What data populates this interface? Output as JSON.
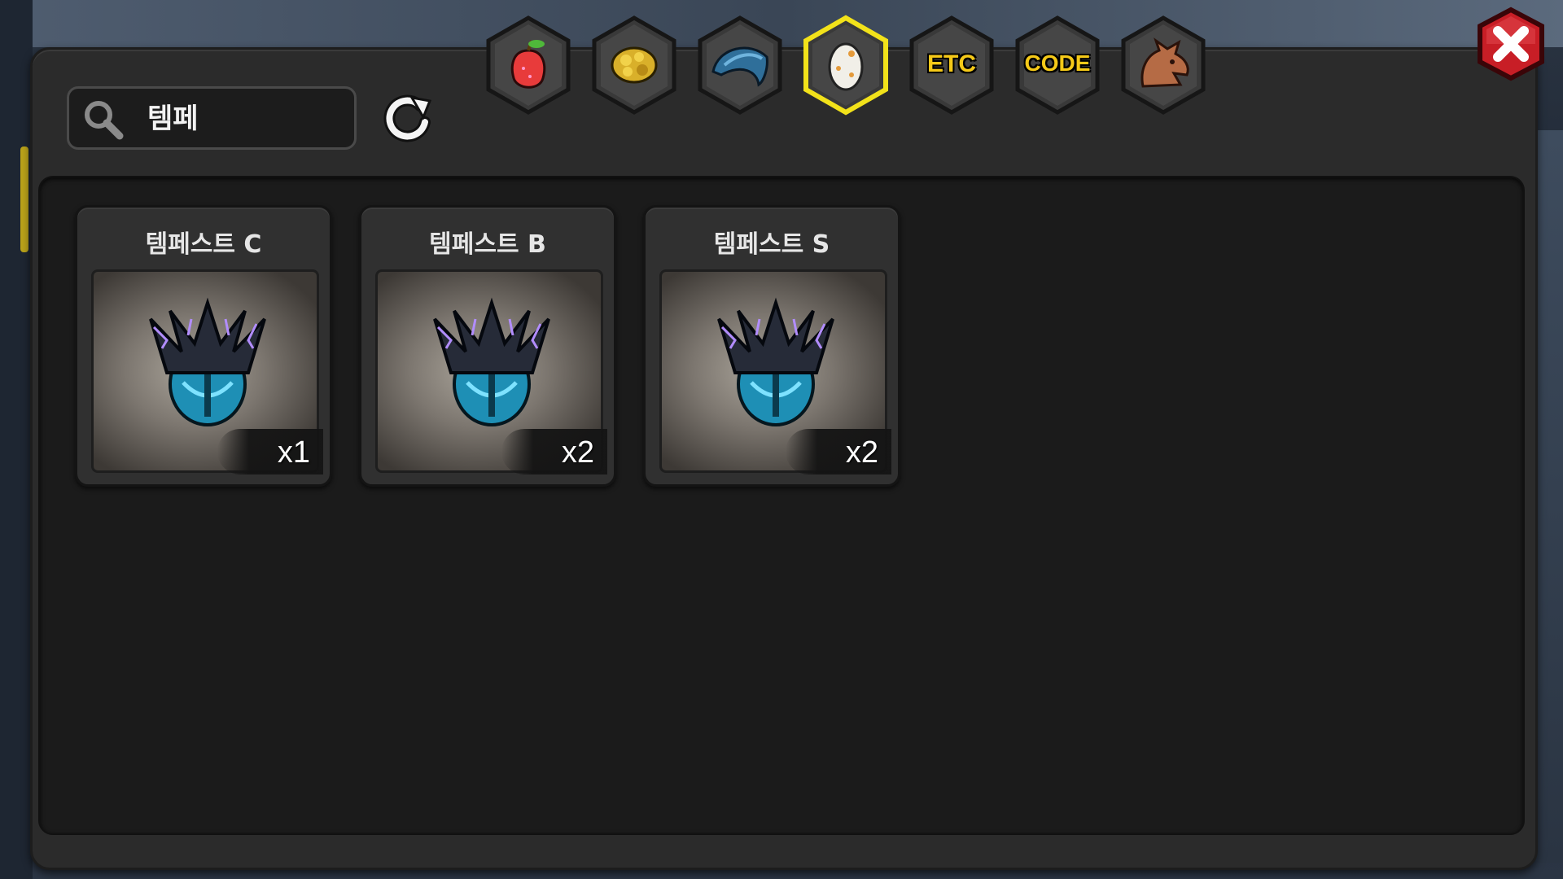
{
  "search": {
    "value": "템페"
  },
  "tabs": [
    {
      "name": "fruit",
      "label": "",
      "selected": false
    },
    {
      "name": "material",
      "label": "",
      "selected": false
    },
    {
      "name": "accessory",
      "label": "",
      "selected": false
    },
    {
      "name": "egg",
      "label": "",
      "selected": true
    },
    {
      "name": "etc",
      "label": "ETC",
      "selected": false
    },
    {
      "name": "code",
      "label": "CODE",
      "selected": false
    },
    {
      "name": "dragon",
      "label": "",
      "selected": false
    }
  ],
  "items": [
    {
      "name": "템페스트 C",
      "quantity": "x1"
    },
    {
      "name": "템페스트 B",
      "quantity": "x2"
    },
    {
      "name": "템페스트 S",
      "quantity": "x2"
    }
  ],
  "colors": {
    "selected_tab_border": "#f2e21a",
    "tab_text": "#f5c918",
    "close_button": "#d8222a"
  }
}
